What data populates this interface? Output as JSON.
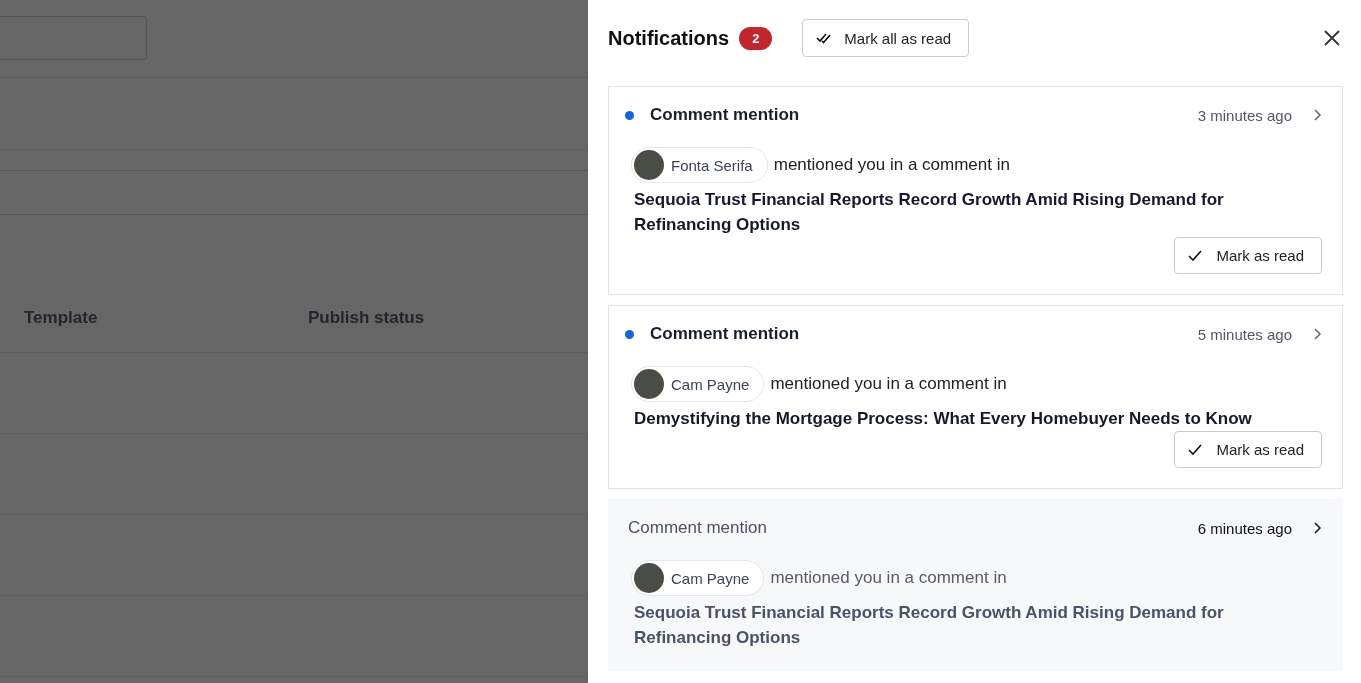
{
  "background": {
    "table": {
      "columns": [
        "Template",
        "Publish status"
      ]
    }
  },
  "panel": {
    "title": "Notifications",
    "unread_count": "2",
    "mark_all_label": "Mark all as read",
    "notifications": [
      {
        "type_label": "Comment mention",
        "time": "3 minutes ago",
        "unread": true,
        "author": "Fonta Serifa",
        "action_text": "mentioned you in a comment in",
        "article_title": "Sequoia Trust Financial Reports Record Growth Amid Rising Demand for Refinancing Options",
        "mark_label": "Mark as read"
      },
      {
        "type_label": "Comment mention",
        "time": "5 minutes ago",
        "unread": true,
        "author": "Cam Payne",
        "action_text": "mentioned you in a comment in",
        "article_title": "Demystifying the Mortgage Process: What Every Homebuyer Needs to Know",
        "mark_label": "Mark as read"
      },
      {
        "type_label": "Comment mention",
        "time": "6 minutes ago",
        "unread": false,
        "author": "Cam Payne",
        "action_text": "mentioned you in a comment in",
        "article_title": "Sequoia Trust Financial Reports Record Growth Amid Rising Demand for Refinancing Options"
      }
    ]
  }
}
